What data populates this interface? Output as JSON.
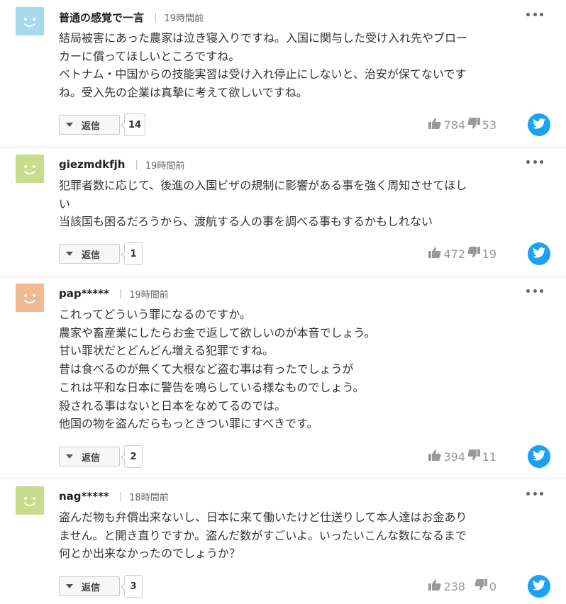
{
  "reply_label": "返信",
  "colors": {
    "twitter": "#1da1f2",
    "vote_gray": "#999999"
  },
  "icons": {
    "reply_toggle": "caret-down-icon",
    "like": "thumbs-up-icon",
    "dislike": "thumbs-down-icon",
    "share": "twitter-icon",
    "menu": "more-dots-icon"
  },
  "comments": [
    {
      "user": "普通の感覚で一言",
      "time": "19時間前",
      "avatar_color": "#a8d8ec",
      "lines": [
        "結局被害にあった農家は泣き寝入りですね。入国に関与した受け入れ先やブロー",
        "カーに償ってほしいところですね。",
        "ベトナム・中国からの技能実習は受け入れ停止にしないと、治安が保てないです",
        "ね。受入先の企業は真摯に考えて欲しいですね。"
      ],
      "replies": "14",
      "likes": "784",
      "dislikes": "53"
    },
    {
      "user": "giezmdkfjh",
      "time": "19時間前",
      "avatar_color": "#c9dc8e",
      "lines": [
        "犯罪者数に応じて、後進の入国ビザの規制に影響がある事を強く周知させてほし",
        "い",
        "当該国も困るだろうから、渡航する人の事を調べる事もするかもしれない"
      ],
      "replies": "1",
      "likes": "472",
      "dislikes": "19"
    },
    {
      "user": "pap*****",
      "time": "19時間前",
      "avatar_color": "#f0b893",
      "lines": [
        "これってどういう罪になるのですか。",
        "農家や畜産業にしたらお金で返して欲しいのが本音でしょう。",
        "甘い罪状だとどんどん増える犯罪ですね。",
        "昔は食べるのが無くて大根など盗む事は有ったでしょうが",
        "これは平和な日本に警告を鳴らしている様なものでしょう。",
        "殺される事はないと日本をなめてるのでは。",
        "他国の物を盗んだらもっときつい罪にすべきです。"
      ],
      "replies": "2",
      "likes": "394",
      "dislikes": "11"
    },
    {
      "user": "nag*****",
      "time": "18時間前",
      "avatar_color": "#c9dc8e",
      "lines": [
        "盗んだ物も弁償出来ないし、日本に来て働いたけど仕送りして本人達はお金あり",
        "ません。と開き直りですか。盗んだ数がすごいよ。いったいこんな数になるまで",
        "何とか出来なかったのでしょうか？"
      ],
      "replies": "3",
      "likes": "238",
      "dislikes": "0"
    }
  ]
}
